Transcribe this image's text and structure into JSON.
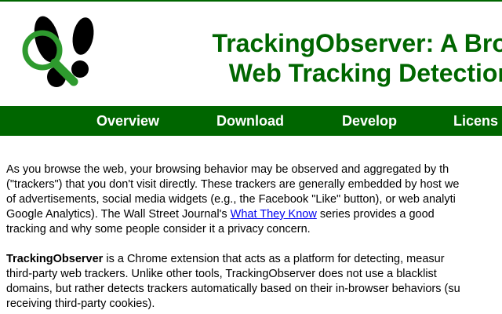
{
  "colors": {
    "brand_green": "#006600",
    "logo_green": "#2e9a2e",
    "link_blue": "#0000ee"
  },
  "header": {
    "logo_icon": "footprints-magnifier-icon",
    "title_line1": "TrackingObserver: A Browser-B",
    "title_line2": "Web Tracking Detection Platf"
  },
  "nav": {
    "items": [
      {
        "label": "Overview"
      },
      {
        "label": "Download"
      },
      {
        "label": "Develop"
      },
      {
        "label": "Licens"
      }
    ]
  },
  "content": {
    "paragraph1": {
      "line1": "As you browse the web, your browsing behavior may be observed and aggregated by th",
      "line2": "(\"trackers\") that you don't visit directly. These trackers are generally embedded by host we",
      "line3": "of advertisements, social media widgets (e.g., the Facebook \"Like\" button), or web analyti",
      "line4_before": "Google Analytics). The Wall Street Journal's ",
      "line4_link": "What They Know",
      "line4_after": " series provides a good",
      "line5": "tracking and why some people consider it a privacy concern."
    },
    "paragraph2": {
      "line1_bold": "TrackingObserver",
      "line1_rest": " is a Chrome extension that acts as a platform for detecting, measur",
      "line2": "third-party web trackers. Unlike other tools, TrackingObserver does not use a blacklist",
      "line3": "domains, but rather detects trackers automatically based on their in-browser behaviors (su",
      "line4": "receiving third-party cookies)."
    }
  }
}
